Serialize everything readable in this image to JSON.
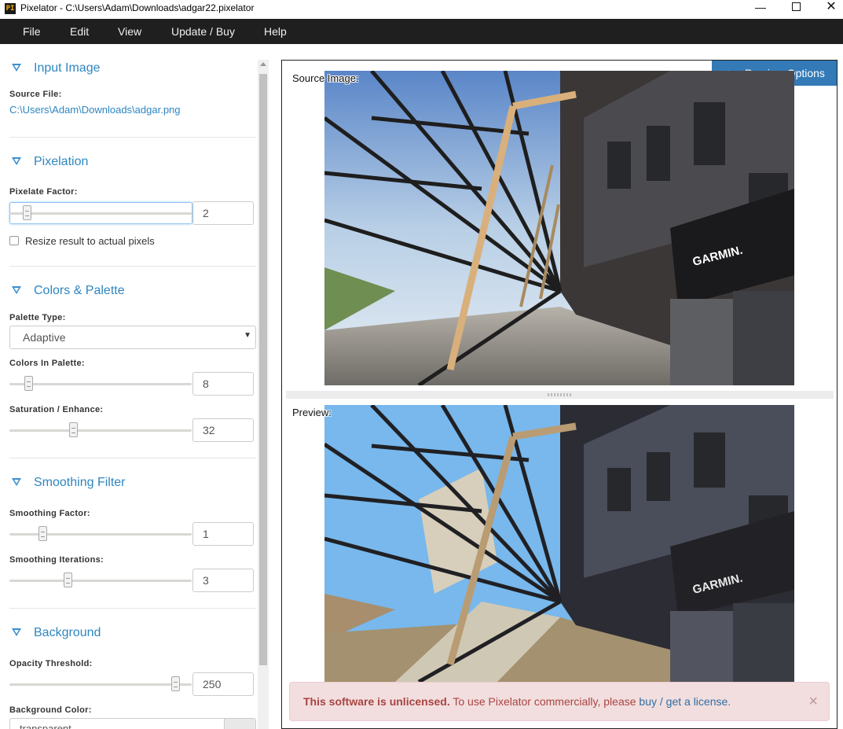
{
  "window": {
    "app_icon": "PI",
    "title": "Pixelator - C:\\Users\\Adam\\Downloads\\adgar22.pixelator",
    "minimize": "—",
    "close": "✕"
  },
  "menu": [
    "File",
    "Edit",
    "View",
    "Update / Buy",
    "Help"
  ],
  "sidebar": {
    "input_image": {
      "title": "Input Image",
      "source_label": "Source File:",
      "source_path": "C:\\Users\\Adam\\Downloads\\adgar.png"
    },
    "pixelation": {
      "title": "Pixelation",
      "factor_label": "Pixelate Factor:",
      "factor_value": "2",
      "resize_label": "Resize result to actual pixels",
      "resize_checked": false
    },
    "colors": {
      "title": "Colors & Palette",
      "palette_type_label": "Palette Type:",
      "palette_type_value": "Adaptive",
      "colors_label": "Colors In Palette:",
      "colors_value": "8",
      "saturation_label": "Saturation / Enhance:",
      "saturation_value": "32"
    },
    "smoothing": {
      "title": "Smoothing Filter",
      "factor_label": "Smoothing Factor:",
      "factor_value": "1",
      "iterations_label": "Smoothing Iterations:",
      "iterations_value": "3"
    },
    "background": {
      "title": "Background",
      "opacity_label": "Opacity Threshold:",
      "opacity_value": "250",
      "color_label": "Background Color:",
      "color_value": "transparent"
    }
  },
  "preview": {
    "options_label": "Preview Options",
    "options_icon": "triangle-up-icon",
    "source_label": "Source Image:",
    "preview_label": "Preview:",
    "sign_text": "GARMIN."
  },
  "alert": {
    "strong": "This software is unlicensed.",
    "text": " To use Pixelator commercially, please ",
    "link": "buy / get a license",
    "end": ".",
    "close": "×"
  },
  "colors": {
    "accent": "#2e86c1",
    "button": "#337ab7",
    "alert_bg": "#f2dede",
    "alert_text": "#a94442",
    "menubar": "#1f1f1f"
  }
}
